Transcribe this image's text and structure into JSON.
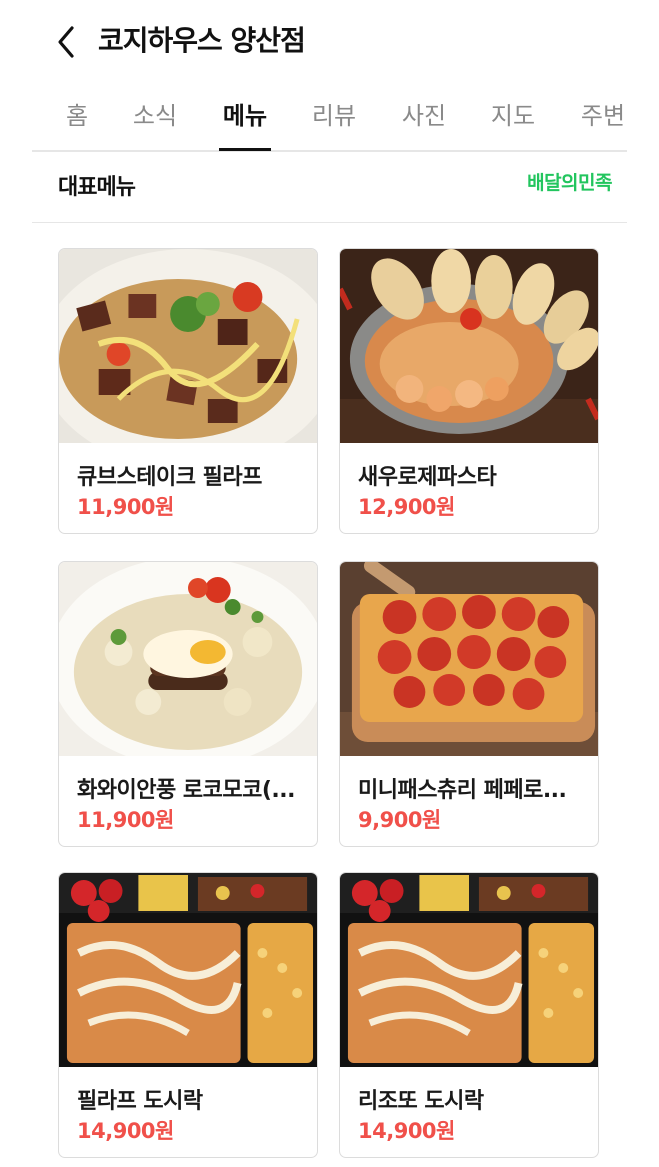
{
  "header": {
    "back_icon": "chevron-left-icon",
    "title": "코지하우스 양산점"
  },
  "tabs": [
    {
      "label": "홈",
      "active": false
    },
    {
      "label": "소식",
      "active": false
    },
    {
      "label": "메뉴",
      "active": true
    },
    {
      "label": "리뷰",
      "active": false
    },
    {
      "label": "사진",
      "active": false
    },
    {
      "label": "지도",
      "active": false
    },
    {
      "label": "주변",
      "active": false
    }
  ],
  "section": {
    "title": "대표메뉴",
    "partner": "배달의민족",
    "partner_color": "#22c55e"
  },
  "menu": [
    {
      "name": "큐브스테이크 필라프",
      "price": "11,900원"
    },
    {
      "name": "새우로제파스타",
      "price": "12,900원"
    },
    {
      "name": "화와이안풍 로코모코(...",
      "price": "11,900원"
    },
    {
      "name": "미니패스츄리 페페로...",
      "price": "9,900원"
    },
    {
      "name": "필라프 도시락",
      "price": "14,900원"
    },
    {
      "name": "리조또 도시락",
      "price": "14,900원"
    }
  ],
  "colors": {
    "price": "#f0504a",
    "active_tab": "#111111",
    "inactive_tab": "#8a8a8a"
  }
}
